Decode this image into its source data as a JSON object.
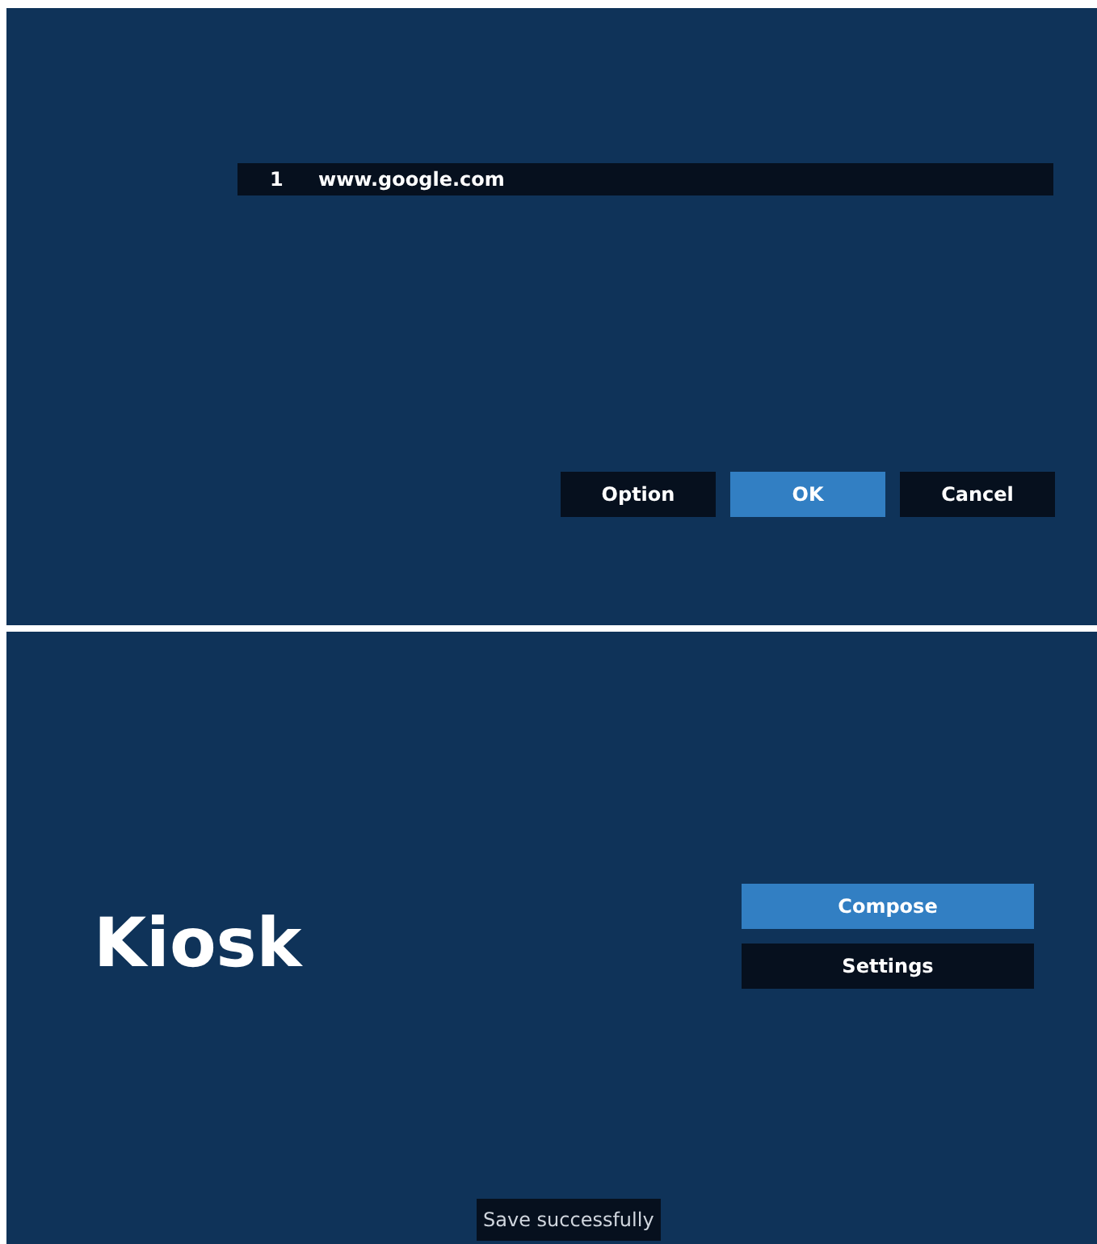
{
  "url_list": {
    "rows": [
      {
        "index": "1",
        "url": "www.google.com",
        "selected": false
      }
    ]
  },
  "dialog_buttons": [
    {
      "label": "Option",
      "selected": false
    },
    {
      "label": "OK",
      "selected": true
    },
    {
      "label": "Cancel",
      "selected": false
    }
  ],
  "kiosk": {
    "title": "Kiosk",
    "menu": [
      {
        "label": "Compose",
        "selected": true
      },
      {
        "label": "Settings",
        "selected": false
      }
    ]
  },
  "toast": "Save successfully"
}
